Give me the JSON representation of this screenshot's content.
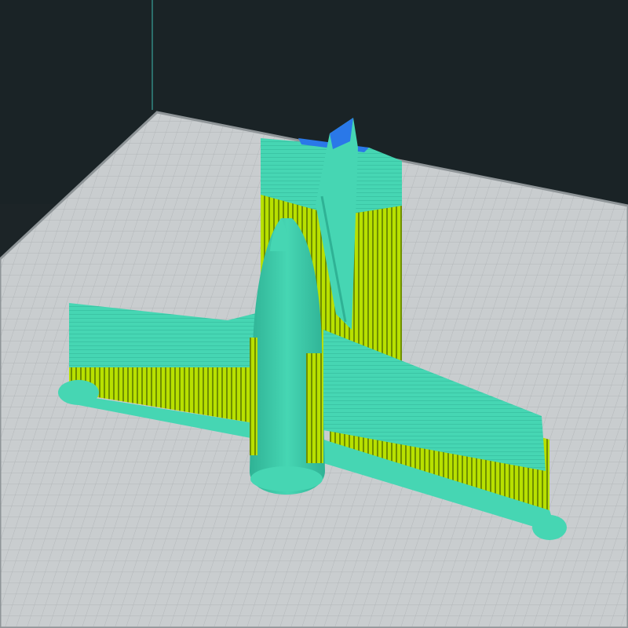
{
  "viewport": {
    "mode": "layer-view",
    "background_color": "#1c2427",
    "back_wall_color": "#1a2326",
    "build_plate_color": "#c9cdcf",
    "grid_line_color": "#a9aeb1",
    "grid_major_color": "#8f9598",
    "axis_line_color": "#3fb9b0"
  },
  "model": {
    "shell_color": "#46d6b3",
    "shell_shadow_color": "#2fb295",
    "support_color": "#b8e000",
    "support_dark_color": "#6f8f00",
    "top_skin_color": "#2a78e8"
  }
}
